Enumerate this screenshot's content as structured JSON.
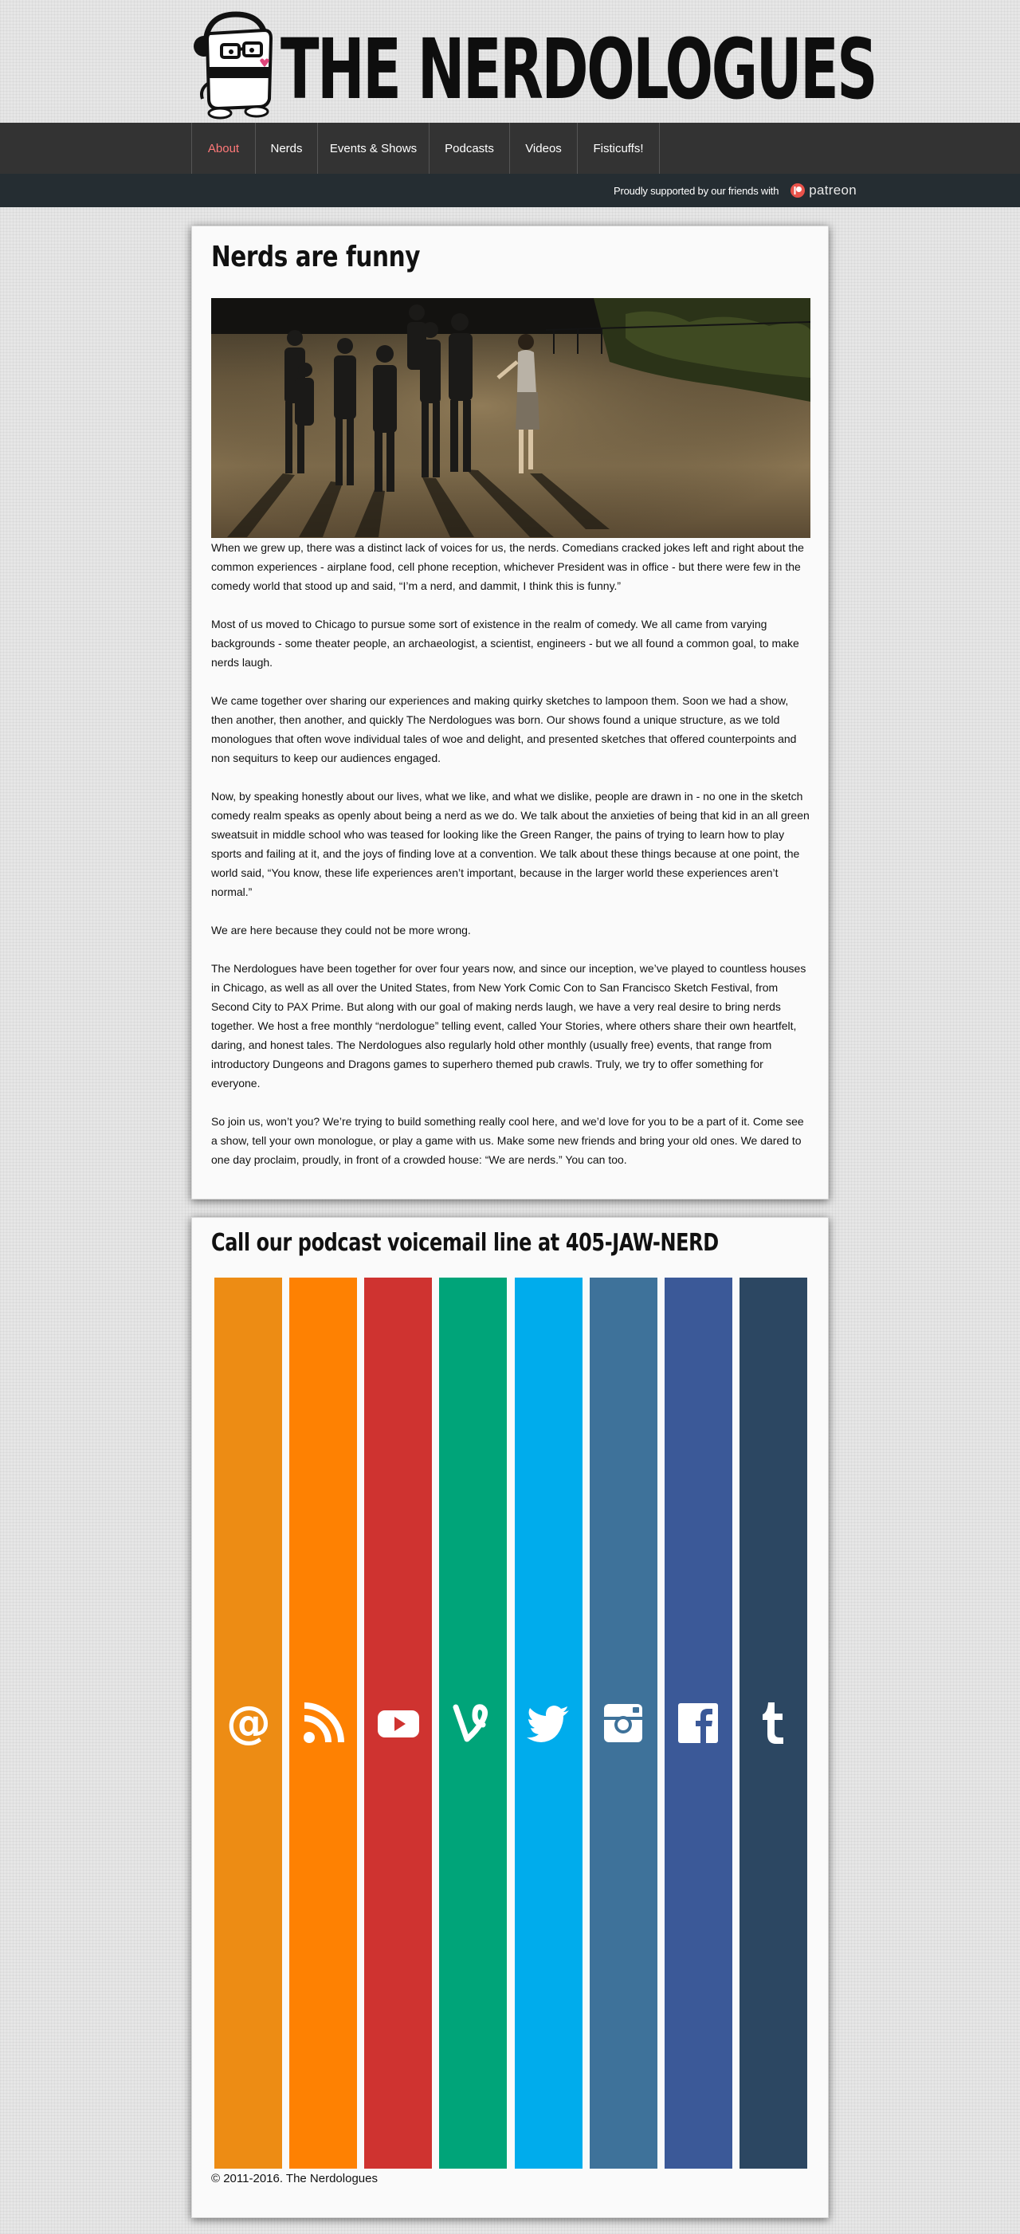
{
  "site": {
    "title": "THE NERDOLOGUES"
  },
  "nav": {
    "items": [
      {
        "label": "About",
        "active": true
      },
      {
        "label": "Nerds",
        "active": false
      },
      {
        "label": "Events & Shows",
        "active": false
      },
      {
        "label": "Podcasts",
        "active": false
      },
      {
        "label": "Videos",
        "active": false
      },
      {
        "label": "Fisticuffs!",
        "active": false
      }
    ]
  },
  "subbar": {
    "support_text": "Proudly supported by our friends with",
    "patreon_label": "patreon"
  },
  "about": {
    "heading": "Nerds are funny",
    "paragraphs": [
      "When we grew up, there was a distinct lack of voices for us, the nerds. Comedians cracked jokes left and right about the common experiences - airplane food, cell phone reception, whichever President was in office - but there were few in the comedy world that stood up and said, “I’m a nerd, and dammit, I think this is funny.”",
      "Most of us moved to Chicago to pursue some sort of existence in the realm of comedy. We all came from varying backgrounds - some theater people, an archaeologist, a scientist, engineers - but we all found a common goal, to make nerds laugh.",
      "We came together over sharing our experiences and making quirky sketches to lampoon them. Soon we had a show, then another, then another, and quickly The Nerdologues was born. Our shows found a unique structure, as we told monologues that often wove individual tales of woe and delight, and presented sketches that offered counterpoints and non sequiturs to keep our audiences engaged.",
      "Now, by speaking honestly about our lives, what we like, and what we dislike, people are drawn in - no one in the sketch comedy realm speaks as openly about being a nerd as we do. We talk about the anxieties of being that kid in an all green sweatsuit in middle school who was teased for looking like the Green Ranger, the pains of trying to learn how to play sports and failing at it, and the joys of finding love at a convention. We talk about these things because at one point, the world said, “You know, these life experiences aren’t important, because in the larger world these experiences aren’t normal.”",
      "We are here because they could not be more wrong.",
      "The Nerdologues have been together for over four years now, and since our inception, we’ve played to countless houses in Chicago, as well as all over the United States, from New York Comic Con to San Francisco Sketch Festival, from Second City to PAX Prime. But along with our goal of making nerds laugh, we have a very real desire to bring nerds together. We host a free monthly “nerdologue” telling event, called Your Stories, where others share their own heartfelt, daring, and honest tales. The Nerdologues also regularly hold other monthly (usually free) events, that range from introductory Dungeons and Dragons games to superhero themed pub crawls. Truly, we try to offer something for everyone.",
      "So join us, won’t you? We’re trying to build something really cool here, and we’d love for you to be a part of it. Come see a show, tell your own monologue, or play a game with us. Make some new friends and bring your old ones. We dared to one day proclaim, proudly, in front of a crowded house: “We are nerds.” You can too."
    ]
  },
  "voicemail": {
    "heading": "Call our podcast voicemail line at 405-JAW-NERD"
  },
  "social": [
    {
      "icon": "email-icon",
      "color": "#ed8c14"
    },
    {
      "icon": "rss-icon",
      "color": "#fe8102"
    },
    {
      "icon": "youtube-icon",
      "color": "#cf3330"
    },
    {
      "icon": "vine-icon",
      "color": "#00a479"
    },
    {
      "icon": "twitter-icon",
      "color": "#00acec"
    },
    {
      "icon": "instagram-icon",
      "color": "#3e729a"
    },
    {
      "icon": "facebook-icon",
      "color": "#3b5998"
    },
    {
      "icon": "tumblr-icon",
      "color": "#2c4762"
    }
  ],
  "footer": {
    "copyright": "© 2011-2016. The Nerdologues"
  }
}
